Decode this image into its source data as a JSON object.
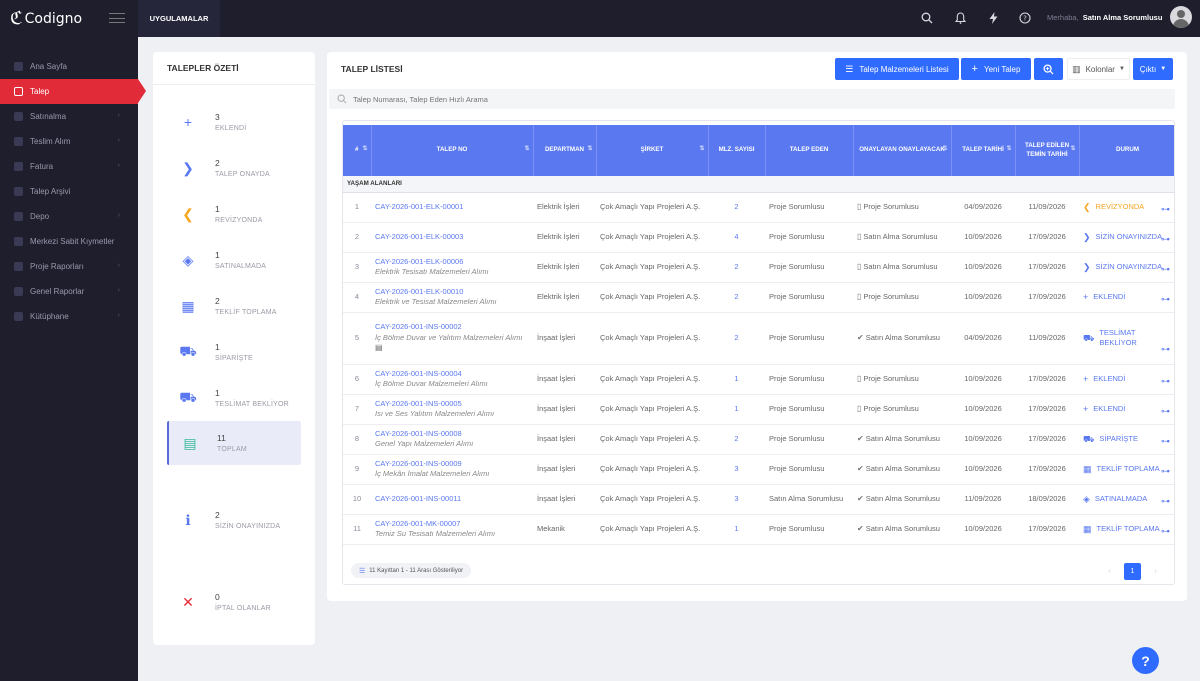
{
  "app": {
    "logo_text": "Codigno",
    "apps_tab": "UYGULAMALAR"
  },
  "header": {
    "greeting": "Merhaba,",
    "user_name": "Satın Alma Sorumlusu"
  },
  "sidebar": {
    "items": [
      {
        "label": "Ana Sayfa",
        "chevron": false
      },
      {
        "label": "Talep",
        "chevron": false,
        "active": true
      },
      {
        "label": "Satınalma",
        "chevron": true
      },
      {
        "label": "Teslim Alım",
        "chevron": true
      },
      {
        "label": "Fatura",
        "chevron": true
      },
      {
        "label": "Talep Arşivi",
        "chevron": false
      },
      {
        "label": "Depo",
        "chevron": true
      },
      {
        "label": "Merkezi Sabit Kıymetler",
        "chevron": false
      },
      {
        "label": "Proje Raporları",
        "chevron": true
      },
      {
        "label": "Genel Raporlar",
        "chevron": true
      },
      {
        "label": "Kütüphane",
        "chevron": true
      }
    ]
  },
  "summary": {
    "title": "TALEPLER ÖZETİ",
    "items": [
      {
        "count": "3",
        "label": "EKLENDİ",
        "icon": "plus-icon",
        "glyph": "+",
        "color": "#5a78f0"
      },
      {
        "count": "2",
        "label": "TALEP ONAYDA",
        "icon": "chevron-right-icon",
        "glyph": "❯",
        "color": "#5a78f0"
      },
      {
        "count": "1",
        "label": "REVİZYONDA",
        "icon": "chevron-left-icon",
        "glyph": "❮",
        "color": "#f5a623"
      },
      {
        "count": "1",
        "label": "SATINALMADA",
        "icon": "layers-icon",
        "glyph": "◈",
        "color": "#5a78f0"
      },
      {
        "count": "2",
        "label": "TEKLİF TOPLAMA",
        "icon": "calendar-icon",
        "glyph": "▦",
        "color": "#5a78f0"
      },
      {
        "count": "1",
        "label": "SİPARİŞTE",
        "icon": "cart-icon",
        "glyph": "⛟",
        "color": "#5a78f0"
      },
      {
        "count": "1",
        "label": "TESLİMAT BEKLİYOR",
        "icon": "truck-icon",
        "glyph": "⛟",
        "color": "#5a78f0"
      },
      {
        "count": "11",
        "label": "TOPLAM",
        "icon": "document-icon",
        "glyph": "▤",
        "color": "#34b89a"
      },
      {
        "count": "2",
        "label": "SİZİN ONAYINIZDA",
        "icon": "info-icon",
        "glyph": "ℹ",
        "color": "#5a78f0"
      },
      {
        "count": "0",
        "label": "İPTAL OLANLAR",
        "icon": "close-icon",
        "glyph": "✕",
        "color": "#e12b38"
      }
    ]
  },
  "list": {
    "title": "TALEP LİSTESİ",
    "buttons": {
      "materials": "Talep Malzemeleri Listesi",
      "new": "Yeni Talep",
      "columns": "Kolonlar",
      "output": "Çıktı"
    },
    "search_placeholder": "Talep Numarası, Talep Eden Hızlı Arama",
    "columns": [
      "#",
      "TALEP NO",
      "DEPARTMAN",
      "ŞİRKET",
      "MLZ. SAYISI",
      "TALEP EDEN",
      "ONAYLAYAN ONAYLAYACAK",
      "TALEP TARİHİ",
      "TALEP EDİLEN TEMİN TARİHİ",
      "DURUM"
    ],
    "group": "YAŞAM ALANLARI",
    "rows": [
      {
        "no": "1",
        "code": "CAY-2026-001-ELK-00001",
        "desc": "",
        "dept": "Elektrik İşleri",
        "company": "Çok Amaçlı Yapı Projeleri A.Ş.",
        "count": "2",
        "requester": "Proje Sorumlusu",
        "approver_icon": "pending-doc-icon",
        "approver": "Proje Sorumlusu",
        "date": "04/09/2026",
        "due": "11/09/2026",
        "status": "REVİZYONDA",
        "status_icon": "chevron-left-icon",
        "status_glyph": "❮",
        "status_color": "#f5a623"
      },
      {
        "no": "2",
        "code": "CAY-2026-001-ELK-00003",
        "desc": "",
        "dept": "Elektrik İşleri",
        "company": "Çok Amaçlı Yapı Projeleri A.Ş.",
        "count": "4",
        "requester": "Proje Sorumlusu",
        "approver_icon": "pending-doc-icon",
        "approver": "Satın Alma Sorumlusu",
        "date": "10/09/2026",
        "due": "17/09/2026",
        "status": "SİZİN ONAYINIZDA",
        "status_icon": "chevron-right-icon",
        "status_glyph": "❯",
        "status_color": "#5a78f0"
      },
      {
        "no": "3",
        "code": "CAY-2026-001-ELK-00006",
        "desc": "Elektrik Tesisatı Malzemeleri Alımı",
        "dept": "Elektrik İşleri",
        "company": "Çok Amaçlı Yapı Projeleri A.Ş.",
        "count": "2",
        "requester": "Proje Sorumlusu",
        "approver_icon": "pending-doc-icon",
        "approver": "Satın Alma Sorumlusu",
        "date": "10/09/2026",
        "due": "17/09/2026",
        "status": "SİZİN ONAYINIZDA",
        "status_icon": "chevron-right-icon",
        "status_glyph": "❯",
        "status_color": "#5a78f0"
      },
      {
        "no": "4",
        "code": "CAY-2026-001-ELK-00010",
        "desc": "Elektrik ve Tesisat Malzemeleri Alımı",
        "dept": "Elektrik İşleri",
        "company": "Çok Amaçlı Yapı Projeleri A.Ş.",
        "count": "2",
        "requester": "Proje Sorumlusu",
        "approver_icon": "pending-doc-icon",
        "approver": "Proje Sorumlusu",
        "date": "10/09/2026",
        "due": "17/09/2026",
        "status": "EKLENDİ",
        "status_icon": "plus-icon",
        "status_glyph": "+",
        "status_color": "#5a78f0"
      },
      {
        "no": "5",
        "code": "CAY-2026-001-INS-00002",
        "desc": "İç Bölme Duvar ve Yalıtım Malzemeleri Alımı",
        "dept": "İnşaat İşleri",
        "company": "Çok Amaçlı Yapı Projeleri A.Ş.",
        "count": "2",
        "requester": "Proje Sorumlusu",
        "approver_icon": "check-icon",
        "approver": "Satın Alma Sorumlusu",
        "date": "04/09/2026",
        "due": "11/09/2026",
        "status": "TESLİMAT BEKLİYOR",
        "status_icon": "truck-icon",
        "status_glyph": "⛟",
        "status_color": "#5a78f0",
        "tall": true
      },
      {
        "no": "6",
        "code": "CAY-2026-001-INS-00004",
        "desc": "İç Bölme Duvar Malzemeleri Alımı",
        "dept": "İnşaat İşleri",
        "company": "Çok Amaçlı Yapı Projeleri A.Ş.",
        "count": "1",
        "requester": "Proje Sorumlusu",
        "approver_icon": "pending-doc-icon",
        "approver": "Proje Sorumlusu",
        "date": "10/09/2026",
        "due": "17/09/2026",
        "status": "EKLENDİ",
        "status_icon": "plus-icon",
        "status_glyph": "+",
        "status_color": "#5a78f0"
      },
      {
        "no": "7",
        "code": "CAY-2026-001-INS-00005",
        "desc": "Isı ve Ses Yalıtım Malzemeleri Alımı",
        "dept": "İnşaat İşleri",
        "company": "Çok Amaçlı Yapı Projeleri A.Ş.",
        "count": "1",
        "requester": "Proje Sorumlusu",
        "approver_icon": "pending-doc-icon",
        "approver": "Proje Sorumlusu",
        "date": "10/09/2026",
        "due": "17/09/2026",
        "status": "EKLENDİ",
        "status_icon": "plus-icon",
        "status_glyph": "+",
        "status_color": "#5a78f0"
      },
      {
        "no": "8",
        "code": "CAY-2026-001-INS-00008",
        "desc": "Genel Yapı Malzemeleri Alımı",
        "dept": "İnşaat İşleri",
        "company": "Çok Amaçlı Yapı Projeleri A.Ş.",
        "count": "2",
        "requester": "Proje Sorumlusu",
        "approver_icon": "check-icon",
        "approver": "Satın Alma Sorumlusu",
        "date": "10/09/2026",
        "due": "17/09/2026",
        "status": "SİPARİŞTE",
        "status_icon": "cart-icon",
        "status_glyph": "⛟",
        "status_color": "#5a78f0"
      },
      {
        "no": "9",
        "code": "CAY-2026-001-INS-00009",
        "desc": "İç Mekân İmalat Malzemeleri Alımı",
        "dept": "İnşaat İşleri",
        "company": "Çok Amaçlı Yapı Projeleri A.Ş.",
        "count": "3",
        "requester": "Proje Sorumlusu",
        "approver_icon": "check-icon",
        "approver": "Satın Alma Sorumlusu",
        "date": "10/09/2026",
        "due": "17/09/2026",
        "status": "TEKLİF TOPLAMA",
        "status_icon": "calendar-icon",
        "status_glyph": "▦",
        "status_color": "#5a78f0"
      },
      {
        "no": "10",
        "code": "CAY-2026-001-INS-00011",
        "desc": "",
        "dept": "İnşaat İşleri",
        "company": "Çok Amaçlı Yapı Projeleri A.Ş.",
        "count": "3",
        "requester": "Satın Alma Sorumlusu",
        "approver_icon": "check-icon",
        "approver": "Satın Alma Sorumlusu",
        "date": "11/09/2026",
        "due": "18/09/2026",
        "status": "SATINALMADA",
        "status_icon": "layers-icon",
        "status_glyph": "◈",
        "status_color": "#5a78f0"
      },
      {
        "no": "11",
        "code": "CAY-2026-001-MK-00007",
        "desc": "Temiz Su Tesisatı Malzemeleri Alımı",
        "dept": "Mekanik",
        "company": "Çok Amaçlı Yapı Projeleri A.Ş.",
        "count": "1",
        "requester": "Proje Sorumlusu",
        "approver_icon": "check-icon",
        "approver": "Satın Alma Sorumlusu",
        "date": "10/09/2026",
        "due": "17/09/2026",
        "status": "TEKLİF TOPLAMA",
        "status_icon": "calendar-icon",
        "status_glyph": "▦",
        "status_color": "#5a78f0"
      }
    ],
    "footer": {
      "count_text": "11 Kayıttan 1 - 11 Arası Gösteriliyor",
      "prev": "‹",
      "page": "1",
      "next": "›"
    }
  },
  "help_label": "?"
}
